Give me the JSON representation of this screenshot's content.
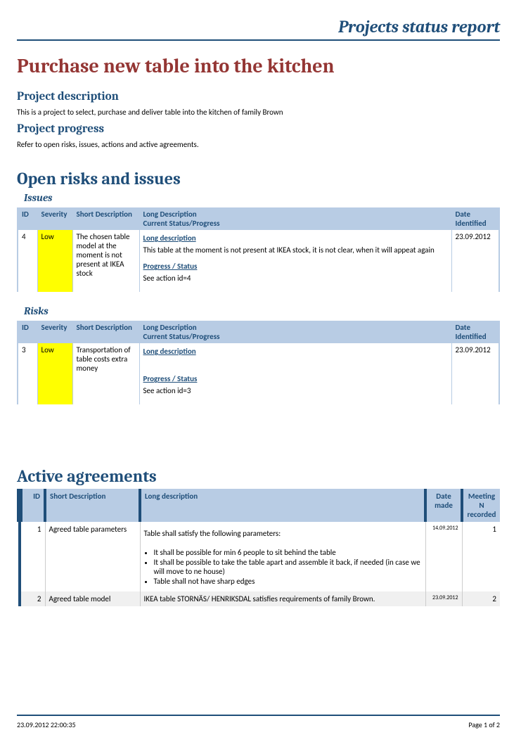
{
  "header": {
    "title": "Projects status report"
  },
  "project": {
    "title": "Purchase new table into the kitchen",
    "description_heading": "Project description",
    "description_text": "This is a project to select, purchase and deliver table into the kitchen of family Brown",
    "progress_heading": "Project progress",
    "progress_text": "Refer to open risks, issues, actions and active agreements."
  },
  "risks_section": {
    "heading": "Open risks and issues",
    "issues_heading": "Issues",
    "risks_heading": "Risks",
    "columns": {
      "id": "ID",
      "severity": "Severity",
      "short": "Short Description",
      "long_header1": "Long Description",
      "long_header2": "Current Status/Progress",
      "date": "Date Identified"
    },
    "labels": {
      "long_desc": "Long description",
      "progress": "Progress / Status"
    },
    "issues": [
      {
        "id": "4",
        "severity": "Low",
        "short": "The chosen  table model at the moment is not present at IKEA stock",
        "long": "This table at the moment is not present at IKEA stock, it is not clear, when it will appeat again",
        "progress": "See action id=4",
        "date": "23.09.2012"
      }
    ],
    "risks": [
      {
        "id": "3",
        "severity": "Low",
        "short": "Transportation of table costs extra money",
        "long": "",
        "progress": "See action id=3",
        "date": "23.09.2012"
      }
    ]
  },
  "agreements_section": {
    "heading": "Active agreements",
    "columns": {
      "id": "ID",
      "short": "Short Description",
      "long": "Long description",
      "date": "Date made",
      "meeting": "Meeting N recorded"
    },
    "rows": [
      {
        "id": "1",
        "short": "Agreed table parameters",
        "long_intro": "Table shall satisfy the following parameters:",
        "bullets": [
          "It shall be possible for min 6 people to sit behind the table",
          "It shall be possible to take the table apart and assemble it back, if needed (in case we will move to ne house)",
          "Table shall not have sharp edges"
        ],
        "date": "14.09.2012",
        "meeting": "1"
      },
      {
        "id": "2",
        "short": "Agreed table model",
        "long_intro": "IKEA table STORNÄS/ HENRIKSDAL satisfies requirements of family Brown.",
        "bullets": [],
        "date": "23.09.2012",
        "meeting": "2"
      }
    ]
  },
  "footer": {
    "timestamp": "23.09.2012 22:00:35",
    "page": "Page 1 of 2"
  }
}
